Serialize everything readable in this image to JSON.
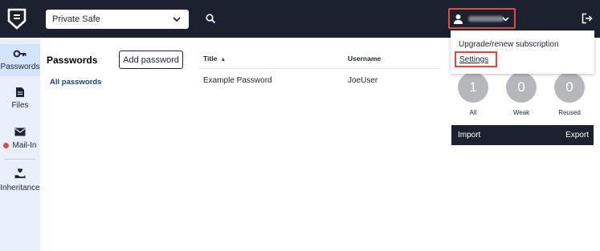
{
  "topbar": {
    "safe_selector": {
      "value": "Private Safe"
    },
    "search_icon": "search-icon",
    "user_menu": {
      "username": "",
      "icon": "user-icon"
    },
    "logout_icon": "logout-icon"
  },
  "user_dropdown": {
    "items": [
      {
        "label": "Upgrade/renew subscription"
      },
      {
        "label": "Settings"
      }
    ]
  },
  "sidebar": {
    "items": [
      {
        "label": "Passwords",
        "icon": "key-icon",
        "active": true
      },
      {
        "label": "Files",
        "icon": "file-icon"
      },
      {
        "label": "Mail-In",
        "icon": "mail-icon",
        "badge_color": "#e0493d"
      },
      {
        "label": "Inheritance",
        "icon": "inheritance-icon"
      }
    ]
  },
  "passwords": {
    "title": "Passwords",
    "add_button": "Add password",
    "filter": "All passwords"
  },
  "table": {
    "columns": [
      "Title",
      "Username"
    ],
    "sort_indicator": "▲",
    "rows": [
      {
        "title": "Example Password",
        "username": "JoeUser"
      }
    ]
  },
  "stats": [
    {
      "value": "1",
      "label": "All"
    },
    {
      "value": "0",
      "label": "Weak"
    },
    {
      "value": "0",
      "label": "Reused"
    }
  ],
  "io": {
    "import": "Import",
    "export": "Export"
  },
  "colors": {
    "topbar": "#1c2130",
    "accent_link": "#1b3f86",
    "highlight": "#e0493d",
    "sidebar_bg": "#eaf0fb"
  }
}
